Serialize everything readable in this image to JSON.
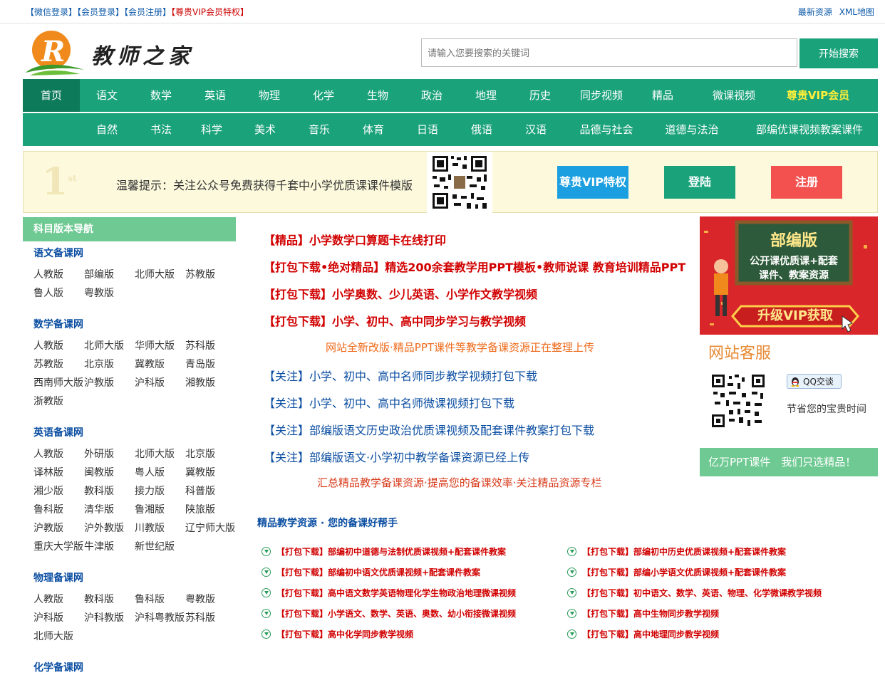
{
  "topbar": {
    "wechat_login": "【微信登录】",
    "member_login": "【会员登录】",
    "member_register": "【会员注册】",
    "vip_privilege": "【尊贵VIP会员特权】",
    "latest": "最新资源",
    "xml_map": "XML地图"
  },
  "header": {
    "logo_text": "教师之家",
    "search_placeholder": "请输入您要搜索的关键词",
    "search_button": "开始搜索"
  },
  "nav1": [
    "首页",
    "语文",
    "数学",
    "英语",
    "物理",
    "化学",
    "生物",
    "政治",
    "地理",
    "历史",
    "同步视频",
    "精品",
    "微课视频",
    "尊贵VIP会员"
  ],
  "nav2": [
    "自然",
    "书法",
    "科学",
    "美术",
    "音乐",
    "体育",
    "日语",
    "俄语",
    "汉语",
    "品德与社会",
    "道德与法治",
    "部编优课视频教案课件"
  ],
  "notice": {
    "badge": "1",
    "badge_sup": "st",
    "tip": "温馨提示：关注公众号免费获得千套中小学优质课课件模版",
    "vip_button": "尊贵VIP特权",
    "login_button": "登陆",
    "register_button": "注册"
  },
  "sidebar": {
    "title": "科目版本导航",
    "groups": [
      {
        "title": "语文备课网",
        "items": [
          "人教版",
          "部编版",
          "北师大版",
          "苏教版",
          "鲁人版",
          "粤教版"
        ]
      },
      {
        "title": "数学备课网",
        "items": [
          "人教版",
          "北师大版",
          "华师大版",
          "苏科版",
          "苏教版",
          "北京版",
          "冀教版",
          "青岛版",
          "西南师大版",
          "沪教版",
          "沪科版",
          "湘教版",
          "浙教版"
        ]
      },
      {
        "title": "英语备课网",
        "items": [
          "人教版",
          "外研版",
          "北师大版",
          "北京版",
          "译林版",
          "闽教版",
          "粤人版",
          "冀教版",
          "湘少版",
          "教科版",
          "接力版",
          "科普版",
          "鲁科版",
          "清华版",
          "鲁湘版",
          "陕旅版",
          "沪教版",
          "沪外教版",
          "川教版",
          "辽宁师大版",
          "重庆大学版",
          "牛津版",
          "新世纪版"
        ]
      },
      {
        "title": "物理备课网",
        "items": [
          "人教版",
          "教科版",
          "鲁科版",
          "粤教版",
          "沪科版",
          "沪科教版",
          "沪科粤教版",
          "苏科版",
          "北师大版"
        ]
      },
      {
        "title": "化学备课网",
        "items": []
      }
    ]
  },
  "announcements": [
    {
      "style": "red",
      "text": "【精品】小学数学口算题卡在线打印"
    },
    {
      "style": "red",
      "text": "【打包下载•绝对精品】精选200余套教学用PPT模板•教师说课 教育培训精品PPT"
    },
    {
      "style": "red",
      "text": "【打包下载】小学奥数、少儿英语、小学作文教学视频"
    },
    {
      "style": "red",
      "text": "【打包下载】小学、初中、高中同步学习与教学视频"
    },
    {
      "style": "orange",
      "text": "网站全新改版·精品PPT课件等教学备课资源正在整理上传"
    },
    {
      "style": "blue",
      "text": "【关注】小学、初中、高中名师同步教学视频打包下载"
    },
    {
      "style": "blue",
      "text": "【关注】小学、初中、高中名师微课视频打包下载"
    },
    {
      "style": "blue",
      "text": "【关注】部编版语文历史政治优质课视频及配套课件教案打包下载"
    },
    {
      "style": "blue",
      "text": "【关注】部编版语文·小学初中教学备课资源已经上传"
    },
    {
      "style": "orange-red",
      "text": "汇总精品教学备课资源·提高您的备课效率·关注精品资源专栏"
    }
  ],
  "promo": {
    "title": "部编版",
    "line1": "公开课优质课+配套",
    "line2": "课件、教案资源",
    "cta": "升级VIP获取"
  },
  "kefu": {
    "title": "网站客服",
    "qq_button": "QQ交谈",
    "note": "节省您的宝贵时间"
  },
  "slogan": "亿万PPT课件　我们只选精品！",
  "resources": {
    "title": "精品教学资源 · 您的备课好帮手",
    "left": [
      "【打包下载】部编初中道德与法制优质课视频+配套课件教案",
      "【打包下载】部编初中语文优质课视频+配套课件教案",
      "【打包下载】高中语文数学英语物理化学生物政治地理微课视频",
      "【打包下载】小学语文、数学、英语、奥数、幼小衔接微课视频",
      "【打包下载】高中化学同步教学视频"
    ],
    "right": [
      "【打包下载】部编初中历史优质课视频+配套课件教案",
      "【打包下载】部编小学语文优质课视频+配套课件教案",
      "【打包下载】初中语文、数学、英语、物理、化学微课教学视频",
      "【打包下载】高中生物同步教学视频",
      "【打包下载】高中地理同步教学视频"
    ]
  },
  "colors": {
    "brand_green": "#1aa27b",
    "light_green": "#6ec992",
    "link_blue": "#0b4ea2",
    "accent_red": "#d10000"
  }
}
